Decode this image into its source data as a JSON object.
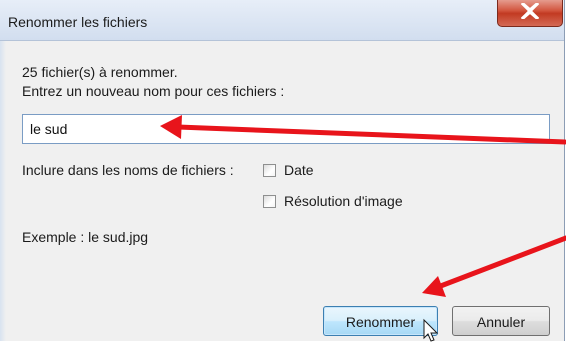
{
  "window": {
    "title": "Renommer les fichiers",
    "close_icon": "close-x-icon"
  },
  "dialog": {
    "count_line": "25 fichier(s) à renommer.",
    "prompt_line": "Entrez un nouveau nom pour ces fichiers :",
    "name_value": "le sud",
    "include_label": "Inclure dans les noms de fichiers :",
    "date_label": "Date",
    "date_checked": false,
    "resolution_label": "Résolution d'image",
    "resolution_checked": false,
    "example_line": "Exemple :  le sud.jpg"
  },
  "buttons": {
    "rename_label": "Renommer",
    "cancel_label": "Annuler"
  },
  "annotation": {
    "arrow_color": "#e8141b",
    "cursor_icon": "mouse-pointer-icon"
  }
}
